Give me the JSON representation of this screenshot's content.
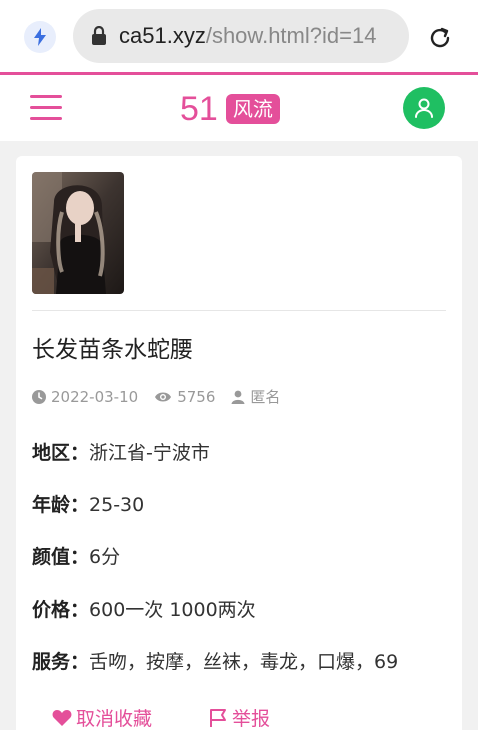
{
  "browser": {
    "url_host": "ca51.xyz",
    "url_path": "/show.html?id=14"
  },
  "site": {
    "logo_number": "51",
    "logo_tag": "风流"
  },
  "post": {
    "title": "长发苗条水蛇腰",
    "date": "2022-03-10",
    "views": "5756",
    "author": "匿名",
    "fields": [
      {
        "label": "地区：",
        "value": "浙江省-宁波市"
      },
      {
        "label": "年龄：",
        "value": "25-30"
      },
      {
        "label": "颜值：",
        "value": "6分"
      },
      {
        "label": "价格：",
        "value": "600一次 1000两次"
      },
      {
        "label": "服务：",
        "value": "舌吻，按摩，丝袜，毒龙，口爆，69"
      }
    ]
  },
  "actions": {
    "unfavorite_label": "取消收藏",
    "report_label": "举报"
  },
  "colors": {
    "accent": "#e44f9a",
    "user_green": "#1fbf62"
  }
}
